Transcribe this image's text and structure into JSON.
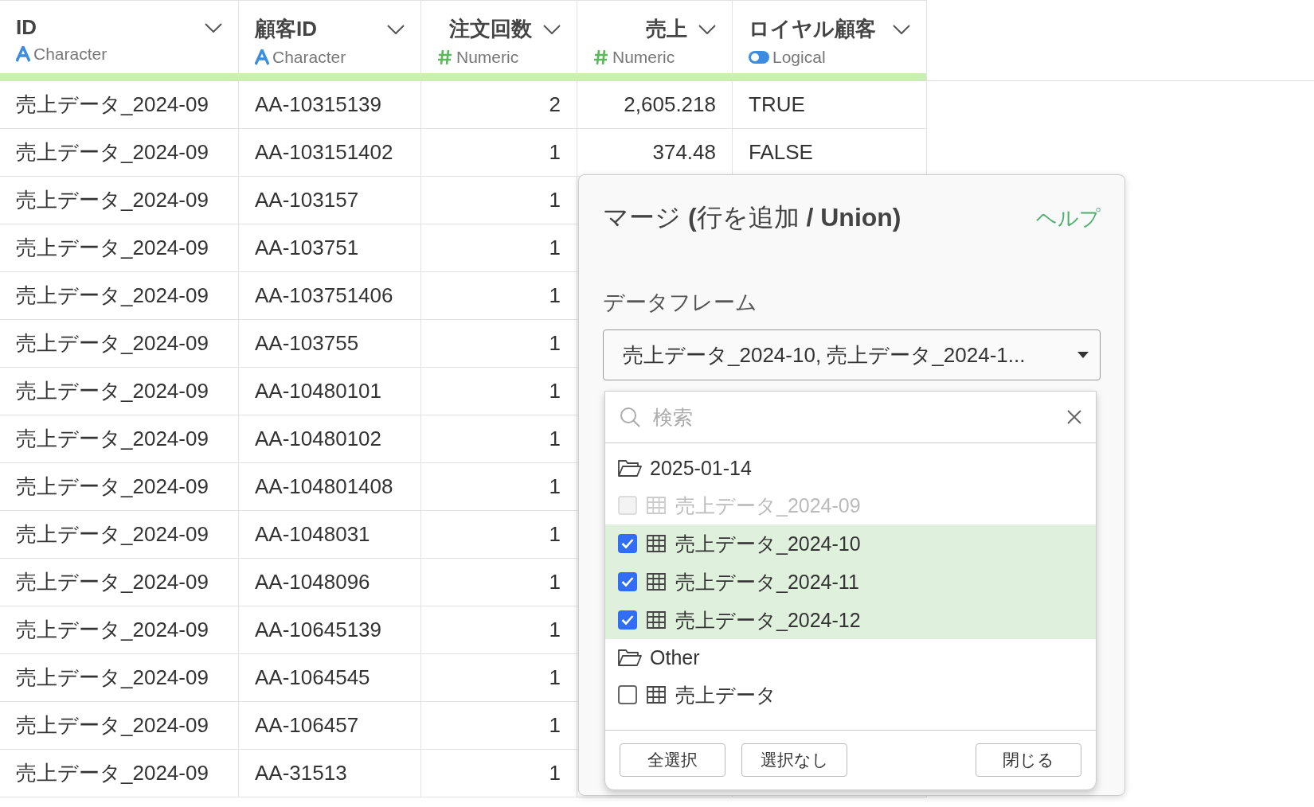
{
  "table": {
    "columns": [
      {
        "name": "ID",
        "type": "Character",
        "kind": "character"
      },
      {
        "name": "顧客ID",
        "type": "Character",
        "kind": "character"
      },
      {
        "name": "注文回数",
        "type": "Numeric",
        "kind": "numeric"
      },
      {
        "name": "売上",
        "type": "Numeric",
        "kind": "numeric"
      },
      {
        "name": "ロイヤル顧客",
        "type": "Logical",
        "kind": "logical"
      }
    ],
    "rows": [
      [
        "売上データ_2024-09",
        "AA-10315139",
        "2",
        "2,605.218",
        "TRUE"
      ],
      [
        "売上データ_2024-09",
        "AA-103151402",
        "1",
        "374.48",
        "FALSE"
      ],
      [
        "売上データ_2024-09",
        "AA-103157",
        "1"
      ],
      [
        "売上データ_2024-09",
        "AA-103751",
        "1"
      ],
      [
        "売上データ_2024-09",
        "AA-103751406",
        "1"
      ],
      [
        "売上データ_2024-09",
        "AA-103755",
        "1"
      ],
      [
        "売上データ_2024-09",
        "AA-10480101",
        "1"
      ],
      [
        "売上データ_2024-09",
        "AA-10480102",
        "1"
      ],
      [
        "売上データ_2024-09",
        "AA-104801408",
        "1"
      ],
      [
        "売上データ_2024-09",
        "AA-1048031",
        "1"
      ],
      [
        "売上データ_2024-09",
        "AA-1048096",
        "1"
      ],
      [
        "売上データ_2024-09",
        "AA-10645139",
        "1"
      ],
      [
        "売上データ_2024-09",
        "AA-1064545",
        "1"
      ],
      [
        "売上データ_2024-09",
        "AA-106457",
        "1"
      ],
      [
        "売上データ_2024-09",
        "AA-31513",
        "1"
      ]
    ]
  },
  "dialog": {
    "title": "マージ **(**行を追加 **/ Union)**",
    "help": "ヘルプ",
    "field_label": "データフレーム",
    "select_value": "売上データ_2024-10, 売上データ_2024-1...",
    "dropdown": {
      "search_placeholder": "検索",
      "groups": [
        {
          "label": "2025-01-14",
          "children": [
            {
              "label": "売上データ_2024-09",
              "checked": false,
              "disabled": true
            },
            {
              "label": "売上データ_2024-10",
              "checked": true,
              "disabled": false
            },
            {
              "label": "売上データ_2024-11",
              "checked": true,
              "disabled": false
            },
            {
              "label": "売上データ_2024-12",
              "checked": true,
              "disabled": false
            }
          ]
        },
        {
          "label": "Other",
          "children": [
            {
              "label": "売上データ",
              "checked": false,
              "disabled": false
            }
          ]
        }
      ],
      "buttons": [
        "全選択",
        "選択なし",
        "閉じる"
      ]
    }
  }
}
